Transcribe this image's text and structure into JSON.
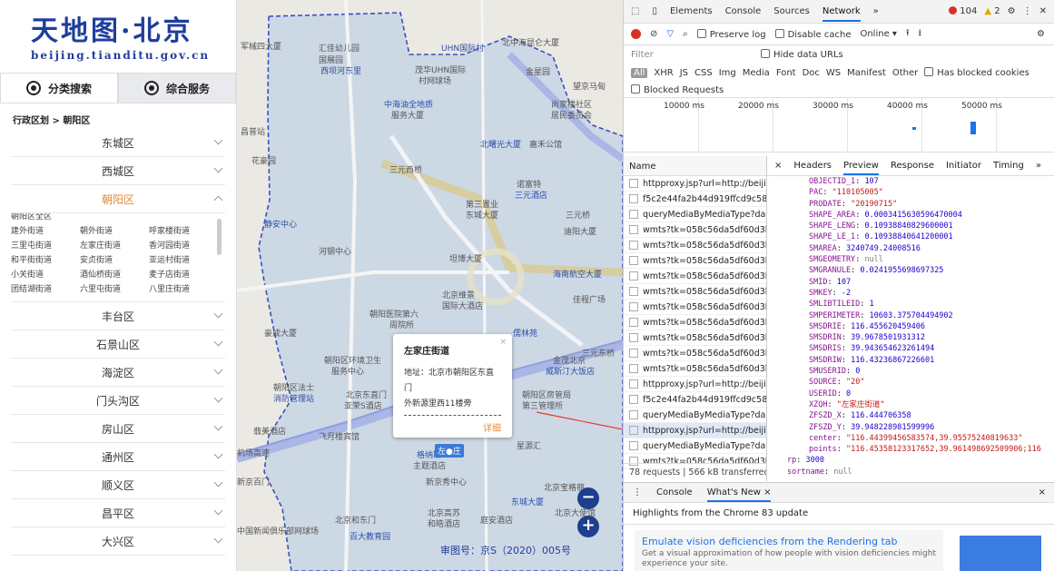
{
  "sidebar": {
    "brand": "天地图·北京",
    "url": "beijing.tianditu.gov.cn",
    "tabs": [
      {
        "label": "分类搜索",
        "active": true
      },
      {
        "label": "综合服务",
        "active": false
      }
    ],
    "breadcrumb": "行政区划 > 朝阳区",
    "districts_top": [
      "东城区",
      "西城区",
      "朝阳区"
    ],
    "open_district": "朝阳区",
    "streets_cutoff": "朝阳区全区",
    "streets": [
      "建外街道",
      "朝外街道",
      "呼家楼街道",
      "三里屯街道",
      "左家庄街道",
      "香河园街道",
      "和平街街道",
      "安贞街道",
      "亚运村街道",
      "小关街道",
      "酒仙桥街道",
      "麦子店街道",
      "团结湖街道",
      "六里屯街道",
      "八里庄街道"
    ],
    "districts_bottom": [
      "丰台区",
      "石景山区",
      "海淀区",
      "门头沟区",
      "房山区",
      "通州区",
      "顺义区",
      "昌平区",
      "大兴区"
    ]
  },
  "map": {
    "labels": [
      "UHN国际村",
      "北中海昆仑大厦",
      "军械四大厦",
      "汇佳幼儿园",
      "国展园",
      "西坝河东里",
      "茂华UHN国际",
      "村网球场",
      "金星园",
      "望京马甸",
      "中海油全地质",
      "服务大厦",
      "尚家楼社区",
      "居民委员会",
      "昌普站",
      "北曙光大厦",
      "嘉禾公馆",
      "三元西桥",
      "花豪园",
      "诺富特",
      "三元酒店",
      "第三置业",
      "东城大厦",
      "三元桥",
      "迪阳大厦",
      "静安中心",
      "河钢中心",
      "北京维景",
      "国际大酒店",
      "坦博大厦",
      "海南航空大厦",
      "佳程广场",
      "朝阳医院第六",
      "周院所",
      "豪成大厦",
      "儒林苑",
      "三元东桥",
      "朝阳区环境卫生",
      "服务中心",
      "朝阳区法士",
      "消防管理站",
      "北京东直门",
      "亚荣S酒店",
      "翡美酒店",
      "飞月楼宾馆",
      "格纳斯",
      "主题酒店",
      "朝阳区房管局",
      "第三管理所",
      "金茂北京",
      "威斯汀大饭店",
      "星源汇",
      "机场高速",
      "新京秀中心",
      "新京百门",
      "东城大厦",
      "北京高苏",
      "和皓酒店",
      "北京宝格丽",
      "北京和东门",
      "百大教育园",
      "中国新闻俱乐部网球场",
      "庭安酒店",
      "北京大使馆"
    ],
    "popup": {
      "title": "左家庄街道",
      "address_line1": "地址：北京市朝阳区东直门",
      "address_line2": "外新源里西11楼旁",
      "divider": "--------------------------------",
      "more": "详细",
      "close": "×"
    },
    "marker": "左●庄",
    "zoom_out": "−",
    "zoom_in": "+",
    "approval": "审图号：京S（2020）005号"
  },
  "devtools": {
    "top_tabs": [
      "Elements",
      "Console",
      "Sources",
      "Network",
      "»"
    ],
    "active_top_tab": "Network",
    "errors": "104",
    "warnings": "2",
    "toolbar": {
      "preserve_log": "Preserve log",
      "disable_cache": "Disable cache",
      "throttle": "Online"
    },
    "filter_placeholder": "Filter",
    "hide_data_urls": "Hide data URLs",
    "types": [
      "All",
      "XHR",
      "JS",
      "CSS",
      "Img",
      "Media",
      "Font",
      "Doc",
      "WS",
      "Manifest",
      "Other"
    ],
    "has_blocked_cookies": "Has blocked cookies",
    "blocked_requests": "Blocked Requests",
    "timeline_ticks": [
      "10000 ms",
      "20000 ms",
      "30000 ms",
      "40000 ms",
      "50000 ms"
    ],
    "name_header": "Name",
    "requests": [
      "httpproxy.jsp?url=http://beijin...",
      "f5c2e44fa2b44d919ffcd9c58...",
      "queryMediaByMediaType?da...",
      "wmts?tk=058c56da5df60d3b...",
      "wmts?tk=058c56da5df60d3b...",
      "wmts?tk=058c56da5df60d3b...",
      "wmts?tk=058c56da5df60d3b...",
      "wmts?tk=058c56da5df60d3b...",
      "wmts?tk=058c56da5df60d3b...",
      "wmts?tk=058c56da5df60d3b...",
      "wmts?tk=058c56da5df60d3b...",
      "wmts?tk=058c56da5df60d3b...",
      "wmts?tk=058c56da5df60d3b...",
      "httpproxy.jsp?url=http://beijin...",
      "f5c2e44fa2b44d919ffcd9c58...",
      "queryMediaByMediaType?da...",
      "httpproxy.jsp?url=http://beijin...",
      "queryMediaByMediaType?da...",
      "wmts?tk=058c56da5df60d3b..."
    ],
    "selected_request_index": 16,
    "request_status": "78 requests | 566 kB transferred",
    "preview_tabs": [
      "×",
      "Headers",
      "Preview",
      "Response",
      "Initiator",
      "Timing",
      "»"
    ],
    "active_preview_tab": "Preview",
    "properties": [
      {
        "k": "OBJECTID_1",
        "v": "107",
        "t": "n"
      },
      {
        "k": "PAC",
        "v": "\"110105005\"",
        "t": "s"
      },
      {
        "k": "PRODATE",
        "v": "\"20190715\"",
        "t": "s"
      },
      {
        "k": "SHAPE_AREA",
        "v": "0.0003415630596470004",
        "t": "n"
      },
      {
        "k": "SHAPE_LENG",
        "v": "0.10938840829600001",
        "t": "n"
      },
      {
        "k": "SHAPE_LE_1",
        "v": "0.10938840641200001",
        "t": "n"
      },
      {
        "k": "SMAREA",
        "v": "3240749.24008516",
        "t": "n"
      },
      {
        "k": "SMGEOMETRY",
        "v": "null",
        "t": "nl"
      },
      {
        "k": "SMGRANULE",
        "v": "0.0241955698697325",
        "t": "n"
      },
      {
        "k": "SMID",
        "v": "107",
        "t": "n"
      },
      {
        "k": "SMKEY",
        "v": "-2",
        "t": "n"
      },
      {
        "k": "SMLIBTILEID",
        "v": "1",
        "t": "n"
      },
      {
        "k": "SMPERIMETER",
        "v": "10603.375704494902",
        "t": "n"
      },
      {
        "k": "SMSDRIE",
        "v": "116.455620459406",
        "t": "n"
      },
      {
        "k": "SMSDRIN",
        "v": "39.9678501931312",
        "t": "n"
      },
      {
        "k": "SMSDRIS",
        "v": "39.943654623261494",
        "t": "n"
      },
      {
        "k": "SMSDRIW",
        "v": "116.43236867226601",
        "t": "n"
      },
      {
        "k": "SMUSERID",
        "v": "0",
        "t": "n"
      },
      {
        "k": "SOURCE",
        "v": "\"20\"",
        "t": "s"
      },
      {
        "k": "USERID",
        "v": "0",
        "t": "n"
      },
      {
        "k": "XZQH",
        "v": "\"左家庄街道\"",
        "t": "s"
      },
      {
        "k": "ZFSZD_X",
        "v": "116.444706358",
        "t": "n"
      },
      {
        "k": "ZFSZD_Y",
        "v": "39.948228981599996",
        "t": "n"
      },
      {
        "k": "center",
        "v": "\"116.44399456583574,39.95575240819633\"",
        "t": "s"
      },
      {
        "k": "points",
        "v": "\"116.45358123317652,39.961498692509906;116",
        "t": "s"
      },
      {
        "k": "rp",
        "v": "3000",
        "t": "n",
        "outer": true
      },
      {
        "k": "sortname",
        "v": "null",
        "t": "nl",
        "outer": true
      }
    ],
    "drawer_tabs": [
      "Console",
      "What's New ×"
    ],
    "active_drawer_tab": "What's New ×",
    "drawer_close": "×",
    "highlights": "Highlights from the Chrome 83 update",
    "card_title": "Emulate vision deficiencies from the Rendering tab",
    "card_desc": "Get a visual approximation of how people with vision deficiencies might experience your site."
  }
}
